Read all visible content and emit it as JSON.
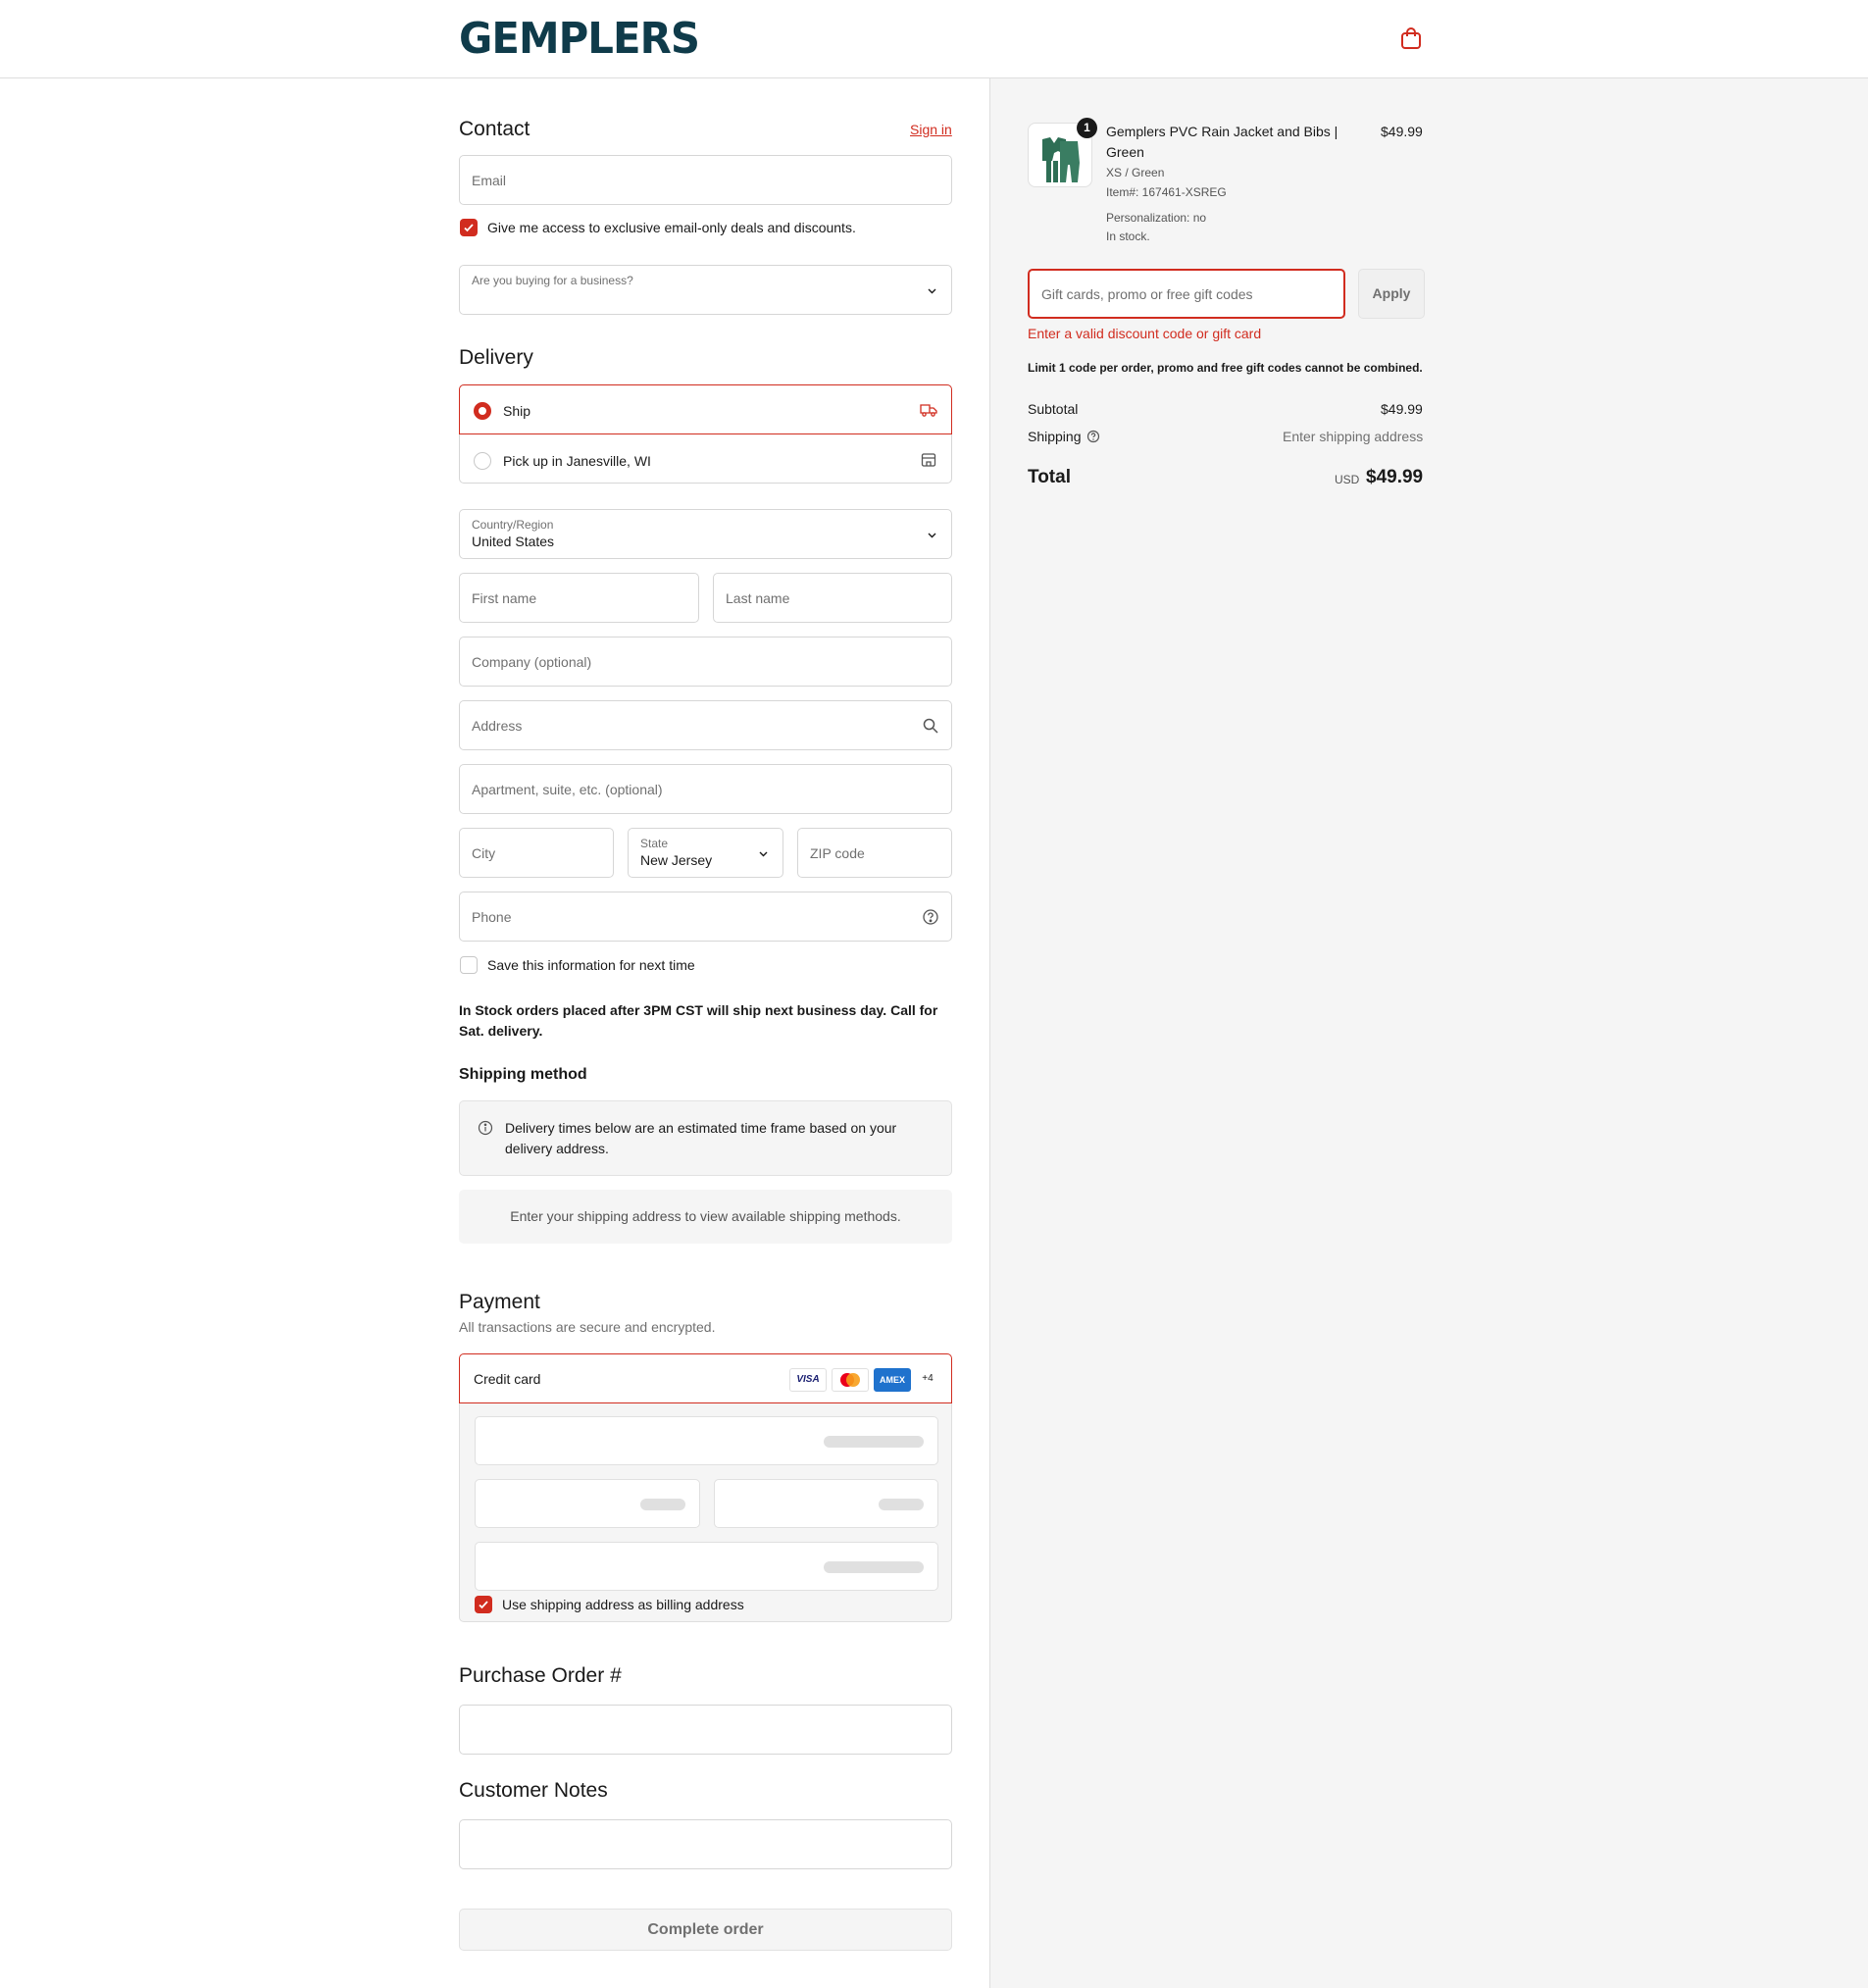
{
  "brand": {
    "logo_text": "GEMPLERS",
    "accent": "#d12c1f",
    "logo_color": "#0f3b4a"
  },
  "header": {
    "cart_icon": "shopping-bag-icon"
  },
  "contact": {
    "title": "Contact",
    "sign_in": "Sign in",
    "email_placeholder": "Email",
    "marketing_label": "Give me access to exclusive email-only deals and discounts.",
    "marketing_checked": true,
    "business_placeholder": "Are you buying for a business?"
  },
  "delivery": {
    "title": "Delivery",
    "options": [
      {
        "label": "Ship",
        "selected": true,
        "icon": "truck-icon"
      },
      {
        "label": "Pick up in Janesville, WI",
        "selected": false,
        "icon": "store-icon"
      }
    ],
    "country_label": "Country/Region",
    "country_value": "United States",
    "first_name": "First name",
    "last_name": "Last name",
    "company": "Company (optional)",
    "address": "Address",
    "apartment": "Apartment, suite, etc. (optional)",
    "city": "City",
    "state_label": "State",
    "state_value": "New Jersey",
    "zip": "ZIP code",
    "phone": "Phone",
    "save_info_label": "Save this information for next time",
    "save_info_checked": false,
    "stock_note": "In Stock orders placed after 3PM CST will ship next business day. Call for Sat. delivery."
  },
  "shipping_method": {
    "title": "Shipping method",
    "info": "Delivery times below are an estimated time frame based on your delivery address.",
    "empty": "Enter your shipping address to view available shipping methods."
  },
  "payment": {
    "title": "Payment",
    "subtitle": "All transactions are secure and encrypted.",
    "method": "Credit card",
    "card_brands": [
      "VISA",
      "mastercard",
      "AMEX",
      "+4"
    ],
    "billing_label": "Use shipping address as billing address",
    "billing_checked": true
  },
  "po": {
    "title": "Purchase Order #"
  },
  "notes": {
    "title": "Customer Notes"
  },
  "complete_button": "Complete order",
  "summary": {
    "item": {
      "name": "Gemplers PVC Rain Jacket and Bibs | Green",
      "name_line1": "Gemplers PVC Rain Jacket and Bibs |",
      "name_line2": "Green",
      "variant": "XS / Green",
      "item_number": "Item#: 167461-XSREG",
      "personalization": "Personalization: no",
      "stock": "In stock.",
      "price": "$49.99",
      "quantity": "1"
    },
    "promo_placeholder": "Gift cards, promo or free gift codes",
    "apply": "Apply",
    "promo_error": "Enter a valid discount code or gift card",
    "limit_note": "Limit 1 code per order, promo and free gift codes cannot be combined.",
    "subtotal_label": "Subtotal",
    "subtotal_value": "$49.99",
    "shipping_label": "Shipping",
    "shipping_value": "Enter shipping address",
    "total_label": "Total",
    "currency": "USD",
    "total_value": "$49.99"
  }
}
